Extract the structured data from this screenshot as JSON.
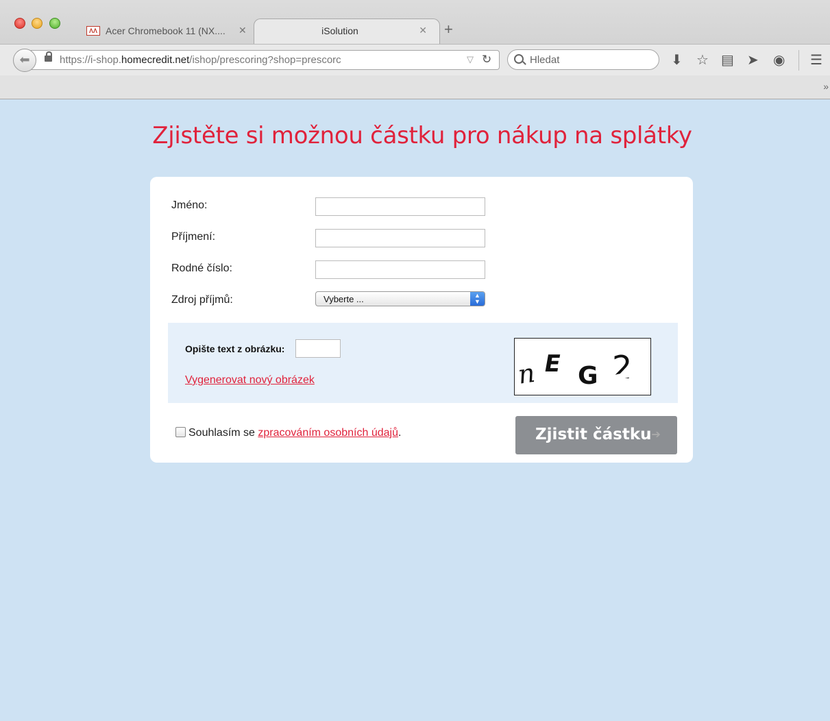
{
  "browser": {
    "tabs": [
      {
        "title": "Acer Chromebook 11 (NX....",
        "active": false,
        "favicon": "alza-logo-icon"
      },
      {
        "title": "iSolution",
        "active": true
      }
    ],
    "url_prefix": "https://i-shop.",
    "url_host": "homecredit.net",
    "url_path": "/ishop/prescoring?shop=prescorc",
    "search_placeholder": "Hledat",
    "icons": [
      "back-arrow-icon",
      "lock-icon",
      "reload-icon",
      "search-icon",
      "download-icon",
      "bookmark-star-icon",
      "reader-icon",
      "send-icon",
      "chat-icon",
      "menu-icon",
      "overflow-chevron-icon"
    ]
  },
  "page": {
    "title": "Zjistěte si možnou částku pro nákup na splátky",
    "form": {
      "first_name_label": "Jméno:",
      "last_name_label": "Příjmení:",
      "birth_number_label": "Rodné číslo:",
      "income_source_label": "Zdroj příjmů:",
      "income_source_value": "Vyberte ...",
      "first_name_value": "",
      "last_name_value": "",
      "birth_number_value": ""
    },
    "captcha": {
      "label": "Opište text z obrázku:",
      "input_value": "",
      "regenerate_link": "Vygenerovat nový obrázek",
      "image_text": "nEG2"
    },
    "consent": {
      "prefix": "Souhlasím se ",
      "link": "zpracováním osobních údajů",
      "suffix": ".",
      "checked": false
    },
    "submit_label": "Zjistit částku"
  },
  "colors": {
    "accent": "#e0223b",
    "page_background": "#cee2f3",
    "captcha_background": "#e6f0fa",
    "submit_background": "#8c8f93"
  }
}
